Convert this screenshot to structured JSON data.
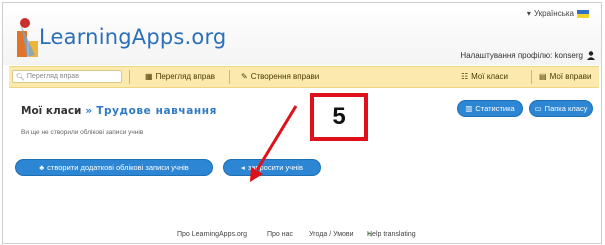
{
  "header": {
    "brand": "LearningApps.org",
    "language": "Українська",
    "profile_settings": "Налаштування профілю: konserg"
  },
  "navbar": {
    "search_placeholder": "Перегляд вправ",
    "browse": "Перегляд вправ",
    "create": "Створення вправи",
    "my_classes": "Мої класи",
    "my_apps": "Мої вправи"
  },
  "main": {
    "breadcrumb_root": "Мої класи",
    "breadcrumb_arrow": "»",
    "breadcrumb_class": "Трудове навчання",
    "no_accounts_note": "Ви ще не створили облікові записи учнів",
    "stats_button": "Статистика",
    "class_folder_button": "Папка класу",
    "create_accounts_button": "створити додаткові облікові записи учнів",
    "invite_button": "запросити учнів"
  },
  "annotation": {
    "step_number": "5",
    "color": "#e0101a"
  },
  "footer": {
    "about": "Про LearningApps.org",
    "about_us": "Про нас",
    "terms": "Угода / Умови",
    "help_translating": "Help translating"
  }
}
